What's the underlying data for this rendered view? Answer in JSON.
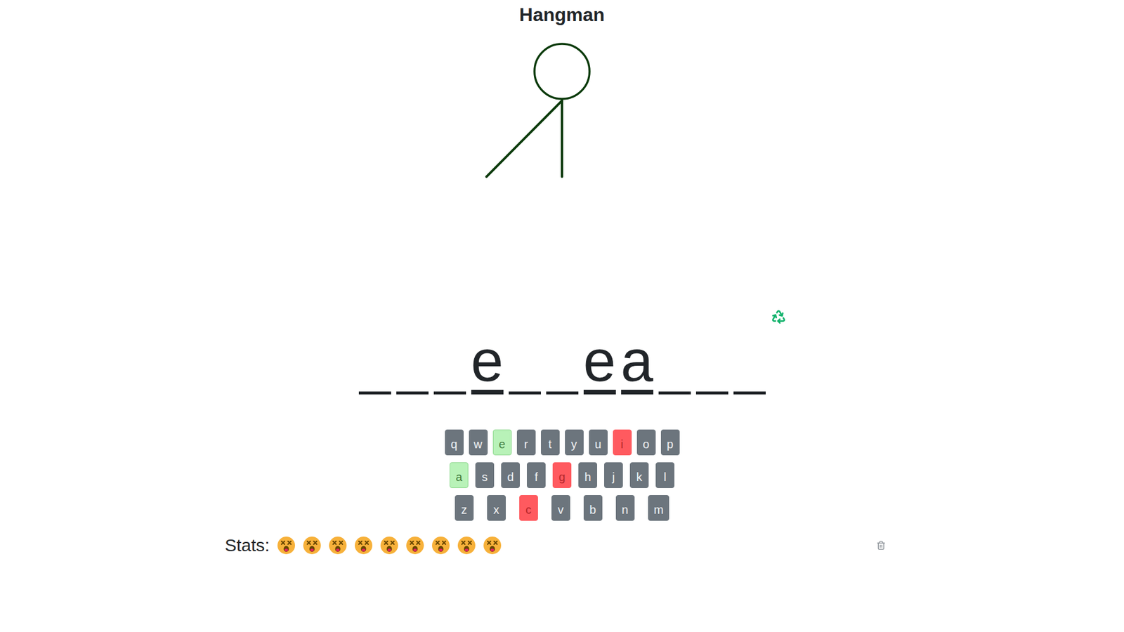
{
  "title": "Hangman",
  "hangman": {
    "parts": [
      {
        "kind": "head",
        "visible": true
      },
      {
        "kind": "body",
        "visible": true
      },
      {
        "kind": "left-arm",
        "visible": true
      },
      {
        "kind": "right-arm",
        "visible": false
      },
      {
        "kind": "left-leg",
        "visible": false
      },
      {
        "kind": "right-leg",
        "visible": false
      }
    ]
  },
  "word": {
    "letters": [
      {
        "letter": "",
        "revealed": false
      },
      {
        "letter": "",
        "revealed": false
      },
      {
        "letter": "",
        "revealed": false
      },
      {
        "letter": "e",
        "revealed": true
      },
      {
        "letter": "",
        "revealed": false
      },
      {
        "letter": "",
        "revealed": false
      },
      {
        "letter": "e",
        "revealed": true
      },
      {
        "letter": "a",
        "revealed": true
      },
      {
        "letter": "",
        "revealed": false
      },
      {
        "letter": "",
        "revealed": false
      },
      {
        "letter": "",
        "revealed": false
      }
    ]
  },
  "keyboard": {
    "rows": [
      [
        {
          "key": "q",
          "status": "unused"
        },
        {
          "key": "w",
          "status": "unused"
        },
        {
          "key": "e",
          "status": "correct"
        },
        {
          "key": "r",
          "status": "unused"
        },
        {
          "key": "t",
          "status": "unused"
        },
        {
          "key": "y",
          "status": "unused"
        },
        {
          "key": "u",
          "status": "unused"
        },
        {
          "key": "i",
          "status": "wrong"
        },
        {
          "key": "o",
          "status": "unused"
        },
        {
          "key": "p",
          "status": "unused"
        }
      ],
      [
        {
          "key": "a",
          "status": "correct"
        },
        {
          "key": "s",
          "status": "unused"
        },
        {
          "key": "d",
          "status": "unused"
        },
        {
          "key": "f",
          "status": "unused"
        },
        {
          "key": "g",
          "status": "wrong"
        },
        {
          "key": "h",
          "status": "unused"
        },
        {
          "key": "j",
          "status": "unused"
        },
        {
          "key": "k",
          "status": "unused"
        },
        {
          "key": "l",
          "status": "unused"
        }
      ],
      [
        {
          "key": "z",
          "status": "unused"
        },
        {
          "key": "x",
          "status": "unused"
        },
        {
          "key": "c",
          "status": "wrong"
        },
        {
          "key": "v",
          "status": "unused"
        },
        {
          "key": "b",
          "status": "unused"
        },
        {
          "key": "n",
          "status": "unused"
        },
        {
          "key": "m",
          "status": "unused"
        }
      ]
    ]
  },
  "stats": {
    "label": "Stats:",
    "games": [
      {
        "won": false
      },
      {
        "won": false
      },
      {
        "won": false
      },
      {
        "won": false
      },
      {
        "won": false
      },
      {
        "won": false
      },
      {
        "won": false
      },
      {
        "won": false
      },
      {
        "won": false
      }
    ]
  }
}
